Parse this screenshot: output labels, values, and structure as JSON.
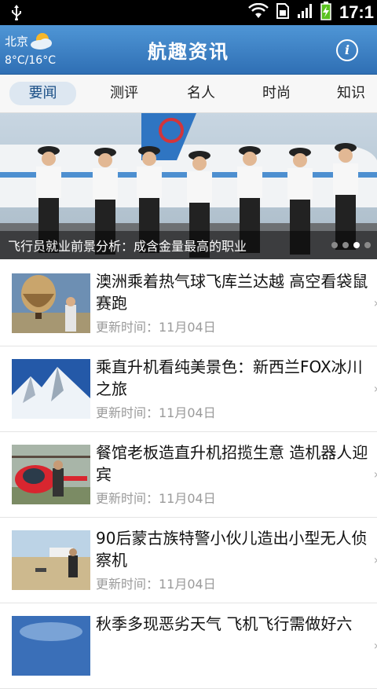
{
  "status_bar": {
    "time": "17:1"
  },
  "header": {
    "city": "北京",
    "temperature": "8°C/16°C",
    "app_title": "航趣资讯",
    "info_icon": "info-icon"
  },
  "tabs": [
    {
      "label": "要闻",
      "active": true
    },
    {
      "label": "测评",
      "active": false
    },
    {
      "label": "名人",
      "active": false
    },
    {
      "label": "时尚",
      "active": false
    },
    {
      "label": "知识",
      "active": false
    }
  ],
  "banner": {
    "caption": "飞行员就业前景分析：成含金量最高的职业",
    "slides_total": 4,
    "slide_current": 3
  },
  "articles": [
    {
      "title": "澳洲乘着热气球飞库兰达越 高空看袋鼠赛跑",
      "updated": "更新时间：11月04日"
    },
    {
      "title": "乘直升机看纯美景色：新西兰FOX冰川之旅",
      "updated": "更新时间：11月04日"
    },
    {
      "title": "餐馆老板造直升机招揽生意 造机器人迎宾",
      "updated": "更新时间：11月04日"
    },
    {
      "title": "90后蒙古族特警小伙儿造出小型无人侦察机",
      "updated": "更新时间：11月04日"
    },
    {
      "title": "秋季多现恶劣天气 飞机飞行需做好六",
      "updated": ""
    }
  ],
  "colors": {
    "header_blue": "#3a7fc4",
    "tab_active_bg": "#dde7f1",
    "meta_gray": "#9a9a9a"
  }
}
